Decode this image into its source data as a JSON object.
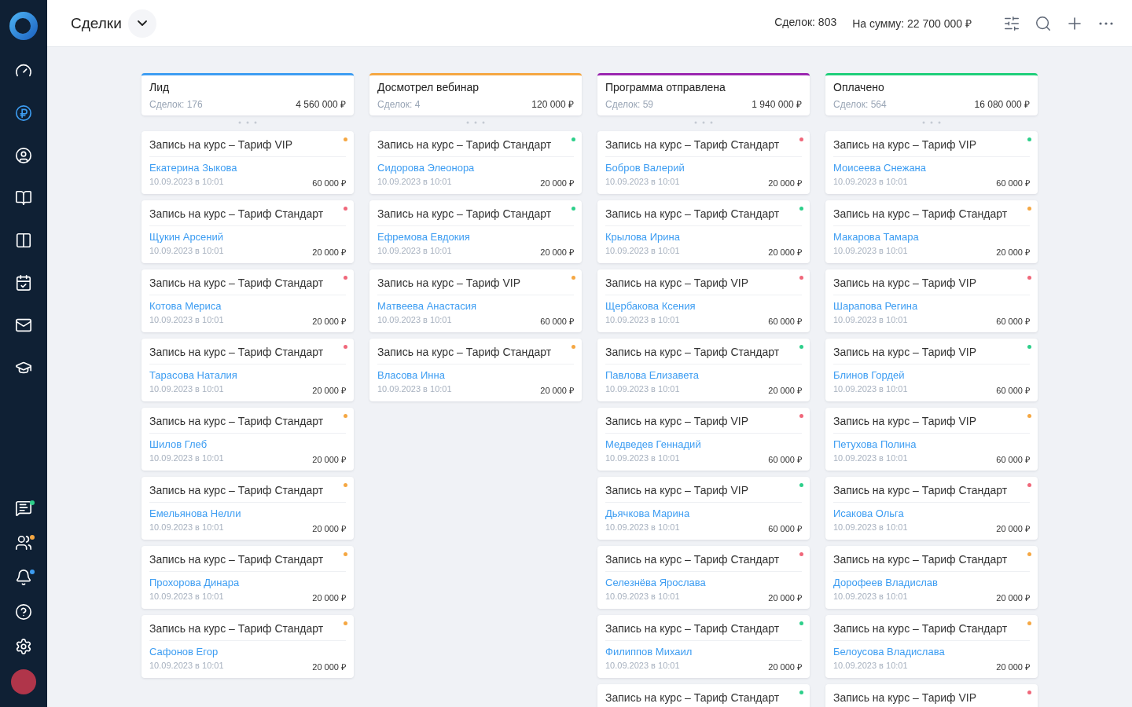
{
  "sidebar": {
    "items": [
      {
        "kind": "dashboard",
        "selected": false
      },
      {
        "kind": "deals",
        "selected": true
      },
      {
        "kind": "contacts",
        "selected": false
      },
      {
        "kind": "products",
        "selected": false
      },
      {
        "kind": "boards",
        "selected": false
      },
      {
        "kind": "calendar",
        "selected": false
      },
      {
        "kind": "mail",
        "selected": false
      },
      {
        "kind": "courses",
        "selected": false
      }
    ],
    "bottom_items": [
      {
        "kind": "chat",
        "selected": false,
        "color": "#2dcf8a"
      },
      {
        "kind": "team",
        "selected": false,
        "color": "#f5a742"
      },
      {
        "kind": "notifications",
        "selected": false,
        "color": "#3d9df2"
      },
      {
        "kind": "help",
        "selected": false
      },
      {
        "kind": "settings",
        "selected": false
      }
    ]
  },
  "header": {
    "title": "Сделки",
    "stats": [
      {
        "label": "Сделок:",
        "value": "803"
      },
      {
        "label": "На сумму:",
        "value": "22 700 000 ₽"
      }
    ]
  },
  "columns": [
    {
      "title": "Лид",
      "color": "#3d9df2",
      "count_label": "Сделок:",
      "count": "176",
      "total": "4 560 000 ₽",
      "cards": [
        {
          "title": "Запись на курс – Тариф VIP",
          "contact": "Екатерина Зыкова",
          "date": "10.09.2023 в 10:01",
          "amount": "60 000 ₽",
          "color": "#f5a742"
        },
        {
          "title": "Запись на курс – Тариф Стандарт",
          "contact": "Щукин Арсений",
          "date": "10.09.2023 в 10:01",
          "amount": "20 000 ₽",
          "color": "#f0677a"
        },
        {
          "title": "Запись на курс – Тариф Стандарт",
          "contact": "Котова Мериса",
          "date": "10.09.2023 в 10:01",
          "amount": "20 000 ₽",
          "color": "#f0677a"
        },
        {
          "title": "Запись на курс – Тариф Стандарт",
          "contact": "Тарасова Наталия",
          "date": "10.09.2023 в 10:01",
          "amount": "20 000 ₽",
          "color": "#f0677a"
        },
        {
          "title": "Запись на курс – Тариф Стандарт",
          "contact": "Шилов Глеб",
          "date": "10.09.2023 в 10:01",
          "amount": "20 000 ₽",
          "color": "#f5a742"
        },
        {
          "title": "Запись на курс – Тариф Стандарт",
          "contact": "Емельянова Нелли",
          "date": "10.09.2023 в 10:01",
          "amount": "20 000 ₽",
          "color": "#f5a742"
        },
        {
          "title": "Запись на курс – Тариф Стандарт",
          "contact": "Прохорова Динара",
          "date": "10.09.2023 в 10:01",
          "amount": "20 000 ₽",
          "color": "#f5a742"
        },
        {
          "title": "Запись на курс – Тариф Стандарт",
          "contact": "Сафонов Егор",
          "date": "10.09.2023 в 10:01",
          "amount": "20 000 ₽",
          "color": "#f5a742"
        }
      ]
    },
    {
      "title": "Досмотрел вебинар",
      "color": "#f5a742",
      "count_label": "Сделок:",
      "count": "4",
      "total": "120 000 ₽",
      "cards": [
        {
          "title": "Запись на курс – Тариф Стандарт",
          "contact": "Сидорова Элеонора",
          "date": "10.09.2023 в 10:01",
          "amount": "20 000 ₽",
          "color": "#2dcf8a"
        },
        {
          "title": "Запись на курс – Тариф Стандарт",
          "contact": "Ефремова Евдокия",
          "date": "10.09.2023 в 10:01",
          "amount": "20 000 ₽",
          "color": "#2dcf8a"
        },
        {
          "title": "Запись на курс – Тариф VIP",
          "contact": "Матвеева Анастасия",
          "date": "10.09.2023 в 10:01",
          "amount": "60 000 ₽",
          "color": "#f5a742"
        },
        {
          "title": "Запись на курс – Тариф Стандарт",
          "contact": "Власова Инна",
          "date": "10.09.2023 в 10:01",
          "amount": "20 000 ₽",
          "color": "#f5a742"
        }
      ]
    },
    {
      "title": "Программа отправлена",
      "color": "#9b27b0",
      "count_label": "Сделок:",
      "count": "59",
      "total": "1 940 000 ₽",
      "cards": [
        {
          "title": "Запись на курс – Тариф Стандарт",
          "contact": "Бобров Валерий",
          "date": "10.09.2023 в 10:01",
          "amount": "20 000 ₽",
          "color": "#f0677a"
        },
        {
          "title": "Запись на курс – Тариф Стандарт",
          "contact": "Крылова Ирина",
          "date": "10.09.2023 в 10:01",
          "amount": "20 000 ₽",
          "color": "#2dcf8a"
        },
        {
          "title": "Запись на курс – Тариф VIP",
          "contact": "Щербакова Ксения",
          "date": "10.09.2023 в 10:01",
          "amount": "60 000 ₽",
          "color": "#f0677a"
        },
        {
          "title": "Запись на курс – Тариф Стандарт",
          "contact": "Павлова Елизавета",
          "date": "10.09.2023 в 10:01",
          "amount": "20 000 ₽",
          "color": "#2dcf8a"
        },
        {
          "title": "Запись на курс – Тариф VIP",
          "contact": "Медведев Геннадий",
          "date": "10.09.2023 в 10:01",
          "amount": "60 000 ₽",
          "color": "#f0677a"
        },
        {
          "title": "Запись на курс – Тариф VIP",
          "contact": "Дьячкова Марина",
          "date": "10.09.2023 в 10:01",
          "amount": "60 000 ₽",
          "color": "#2dcf8a"
        },
        {
          "title": "Запись на курс – Тариф Стандарт",
          "contact": "Селезнёва Ярослава",
          "date": "10.09.2023 в 10:01",
          "amount": "20 000 ₽",
          "color": "#f0677a"
        },
        {
          "title": "Запись на курс – Тариф Стандарт",
          "contact": "Филиппов Михаил",
          "date": "10.09.2023 в 10:01",
          "amount": "20 000 ₽",
          "color": "#2dcf8a"
        },
        {
          "title": "Запись на курс – Тариф Стандарт",
          "color": "#2dcf8a"
        }
      ]
    },
    {
      "title": "Оплачено",
      "color": "#1fcf7a",
      "count_label": "Сделок:",
      "count": "564",
      "total": "16 080 000 ₽",
      "cards": [
        {
          "title": "Запись на курс – Тариф VIP",
          "contact": "Моисеева Снежана",
          "date": "10.09.2023 в 10:01",
          "amount": "60 000 ₽",
          "color": "#2dcf8a"
        },
        {
          "title": "Запись на курс – Тариф Стандарт",
          "contact": "Макарова Тамара",
          "date": "10.09.2023 в 10:01",
          "amount": "20 000 ₽",
          "color": "#f5a742"
        },
        {
          "title": "Запись на курс – Тариф VIP",
          "contact": "Шарапова Регина",
          "date": "10.09.2023 в 10:01",
          "amount": "60 000 ₽",
          "color": "#f0677a"
        },
        {
          "title": "Запись на курс – Тариф VIP",
          "contact": "Блинов Гордей",
          "date": "10.09.2023 в 10:01",
          "amount": "60 000 ₽",
          "color": "#2dcf8a"
        },
        {
          "title": "Запись на курс – Тариф VIP",
          "contact": "Петухова Полина",
          "date": "10.09.2023 в 10:01",
          "amount": "60 000 ₽",
          "color": "#f5a742"
        },
        {
          "title": "Запись на курс – Тариф Стандарт",
          "contact": "Исакова Ольга",
          "date": "10.09.2023 в 10:01",
          "amount": "20 000 ₽",
          "color": "#f0677a"
        },
        {
          "title": "Запись на курс – Тариф Стандарт",
          "contact": "Дорофеев Владислав",
          "date": "10.09.2023 в 10:01",
          "amount": "20 000 ₽",
          "color": "#f5a742"
        },
        {
          "title": "Запись на курс – Тариф Стандарт",
          "contact": "Белоусова Владислава",
          "date": "10.09.2023 в 10:01",
          "amount": "20 000 ₽",
          "color": "#f5a742"
        },
        {
          "title": "Запись на курс – Тариф VIP",
          "color": "#f0677a"
        }
      ]
    }
  ]
}
